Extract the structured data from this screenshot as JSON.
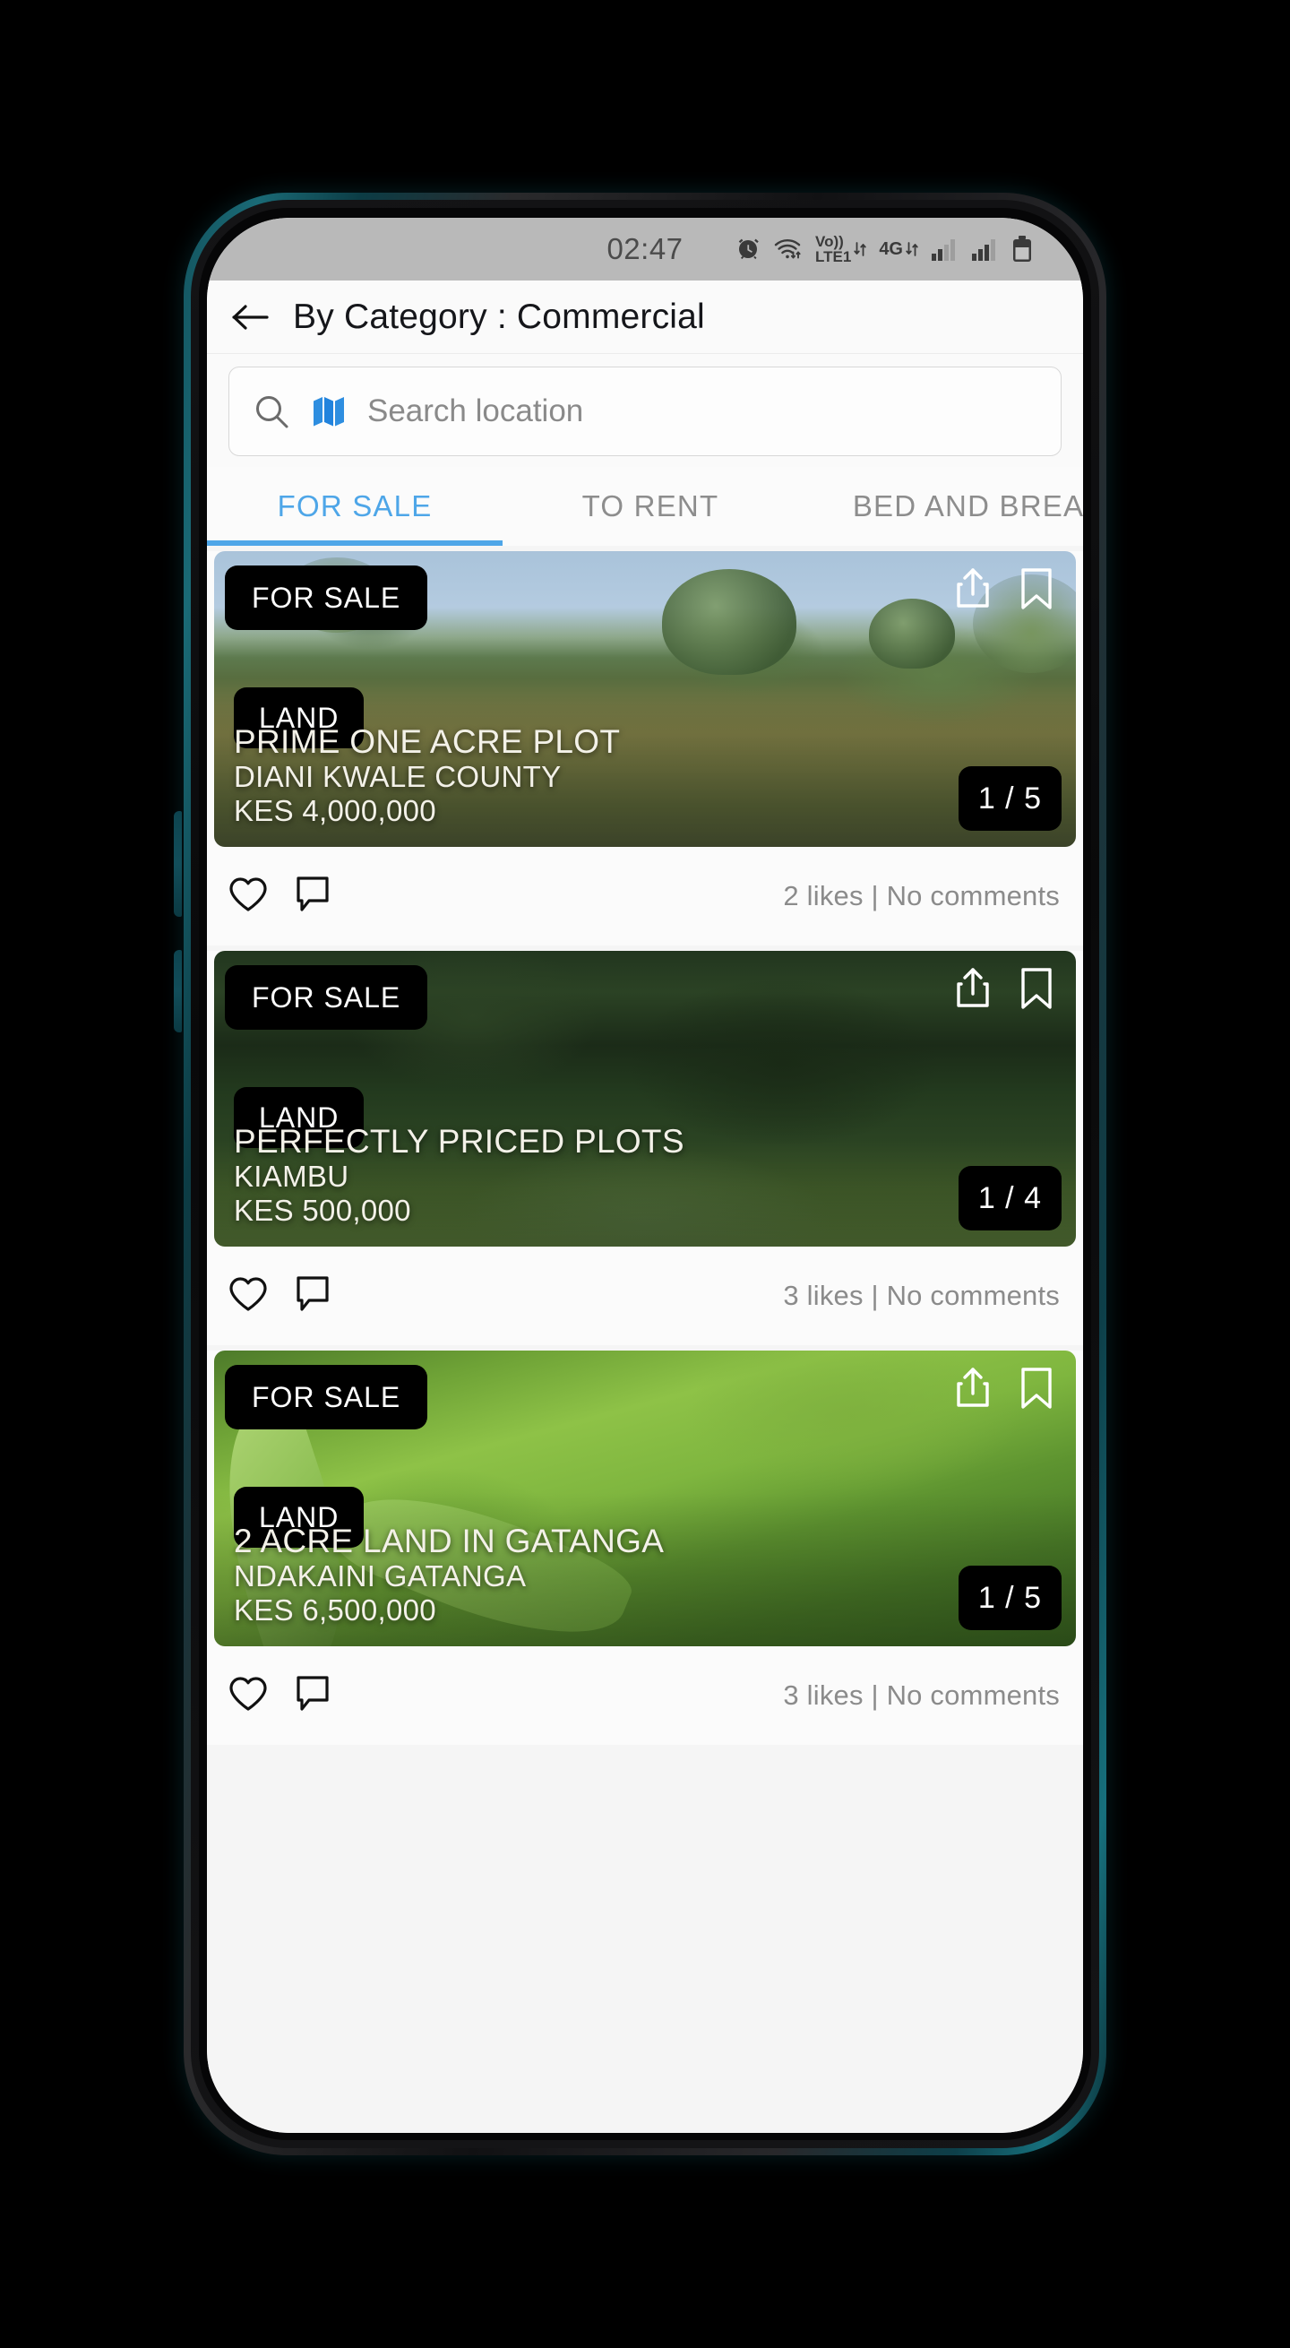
{
  "status_bar": {
    "time": "02:47",
    "icons": [
      {
        "name": "alarm-icon"
      },
      {
        "name": "wifi-icon"
      },
      {
        "name": "volte-icon",
        "line1": "Vo))",
        "line2": "LTE1"
      },
      {
        "name": "network-4g-icon",
        "label": "4G"
      },
      {
        "name": "signal-bars-sim1-icon"
      },
      {
        "name": "signal-bars-sim2-icon"
      },
      {
        "name": "battery-icon"
      }
    ]
  },
  "header": {
    "back_label": "back",
    "title": "By Category  :  Commercial"
  },
  "search": {
    "placeholder": "Search location",
    "value": "",
    "search_icon": "search-icon",
    "map_icon": "map-icon",
    "map_icon_color": "#2e8ee0"
  },
  "tabs": {
    "active_index": 0,
    "accent_color": "#4ea6e8",
    "items": [
      {
        "label": "FOR SALE"
      },
      {
        "label": "TO RENT"
      },
      {
        "label": "BED AND BREA"
      }
    ]
  },
  "listings": [
    {
      "status_badge": "FOR SALE",
      "type_badge": "LAND",
      "title": "PRIME ONE ACRE PLOT",
      "location": "DIANI KWALE COUNTY",
      "price": "KES 4,000,000",
      "image_counter": "1 / 5",
      "likes_comments": "2 likes | No comments"
    },
    {
      "status_badge": "FOR SALE",
      "type_badge": "LAND",
      "title": "PERFECTLY PRICED PLOTS",
      "location": "KIAMBU",
      "price": "KES 500,000",
      "image_counter": "1 / 4",
      "likes_comments": "3 likes | No comments"
    },
    {
      "status_badge": "FOR SALE",
      "type_badge": "LAND",
      "title": "2 ACRE LAND IN GATANGA",
      "location": "NDAKAINI GATANGA",
      "price": "KES 6,500,000",
      "image_counter": "1 / 5",
      "likes_comments": "3 likes | No comments"
    }
  ]
}
